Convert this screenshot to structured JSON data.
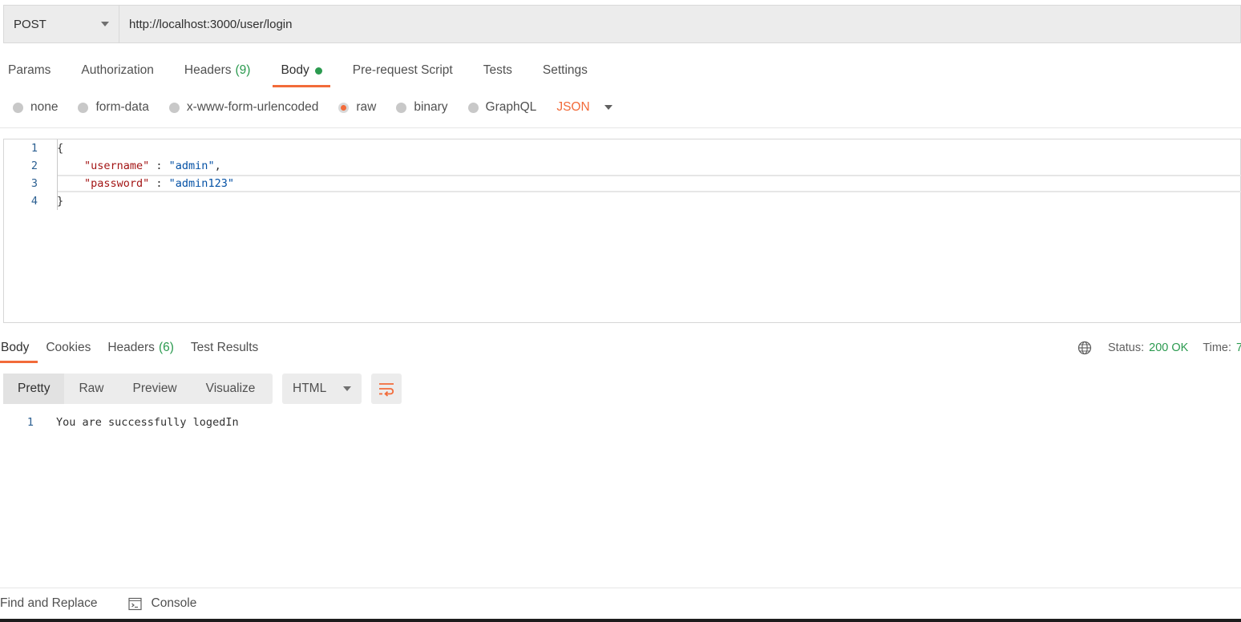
{
  "request": {
    "method": "POST",
    "url": "http://localhost:3000/user/login"
  },
  "request_tabs": [
    {
      "label": "Params",
      "count": ""
    },
    {
      "label": "Authorization",
      "count": ""
    },
    {
      "label": "Headers",
      "count": "(9)"
    },
    {
      "label": "Body",
      "count": "",
      "active": true
    },
    {
      "label": "Pre-request Script",
      "count": ""
    },
    {
      "label": "Tests",
      "count": ""
    },
    {
      "label": "Settings",
      "count": ""
    }
  ],
  "body_options": {
    "none": "none",
    "form_data": "form-data",
    "urlencoded": "x-www-form-urlencoded",
    "raw": "raw",
    "binary": "binary",
    "graphql": "GraphQL",
    "format": "JSON",
    "selected": "raw"
  },
  "editor": {
    "line_numbers": [
      "1",
      "2",
      "3",
      "4"
    ],
    "open_brace": "{",
    "close_brace": "}",
    "username_key": "\"username\"",
    "username_value": "\"admin\"",
    "password_key": "\"password\"",
    "password_value": "\"admin123\"",
    "colon": " : ",
    "comma": ","
  },
  "response_tabs": [
    {
      "label": "Body",
      "count": "",
      "active": true
    },
    {
      "label": "Cookies",
      "count": ""
    },
    {
      "label": "Headers",
      "count": "(6)"
    },
    {
      "label": "Test Results",
      "count": ""
    }
  ],
  "response_status": {
    "status_label": "Status:",
    "status_value": "200 OK",
    "time_label": "Time:",
    "time_value": "7"
  },
  "response_view": {
    "modes": [
      "Pretty",
      "Raw",
      "Preview",
      "Visualize"
    ],
    "active_mode": "Pretty",
    "format": "HTML"
  },
  "response_body": {
    "line_number": "1",
    "text": "You are successfully logedIn"
  },
  "footer": {
    "find_replace": "Find and Replace",
    "console": "Console"
  },
  "colors": {
    "accent": "#f26b3a",
    "success": "#2b9a4f"
  }
}
